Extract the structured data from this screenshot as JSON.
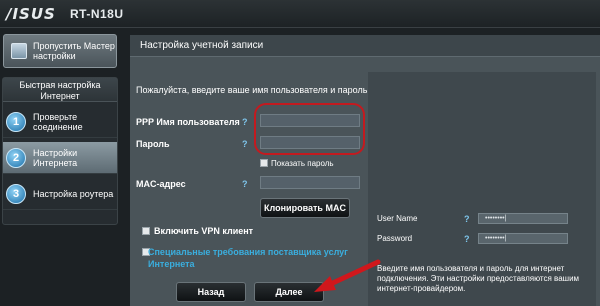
{
  "header": {
    "logo": "/ISUS",
    "model": "RT-N18U"
  },
  "sidebar": {
    "wizard_button": "Пропустить Мастер настройки",
    "quick_setup_title": "Быстрая настройка Интернет",
    "steps": [
      {
        "num": "1",
        "label": "Проверьте соединение"
      },
      {
        "num": "2",
        "label": "Настройки Интернета"
      },
      {
        "num": "3",
        "label": "Настройка роутера"
      }
    ]
  },
  "main": {
    "section_title": "Настройка учетной записи",
    "instruction": "Пожалуйста, введите ваше имя пользователя и пароль",
    "ppp_username_label": "PPP Имя пользователя",
    "password_label": "Пароль",
    "show_password_label": "Показать пароль",
    "mac_label": "MAC-адрес",
    "clone_mac_button": "Клонировать MAC",
    "vpn_client_label": "Включить VPN клиент",
    "isp_requirements_label": "Специальные требования поставщика услуг Интернета",
    "back_button": "Назад",
    "next_button": "Далее",
    "help_symbol": "?"
  },
  "info": {
    "username_label": "User Name",
    "username_value": "••••••••|",
    "password_label": "Password",
    "password_value": "••••••••|",
    "description": "Введите имя пользователя и пароль для интернет подключения. Эти настройки предоставляются вашим интернет-провайдером."
  },
  "colors": {
    "background": "#1c2124",
    "panel": "#4a5459",
    "accent_link": "#3aaede",
    "highlight": "#c31a1f"
  }
}
